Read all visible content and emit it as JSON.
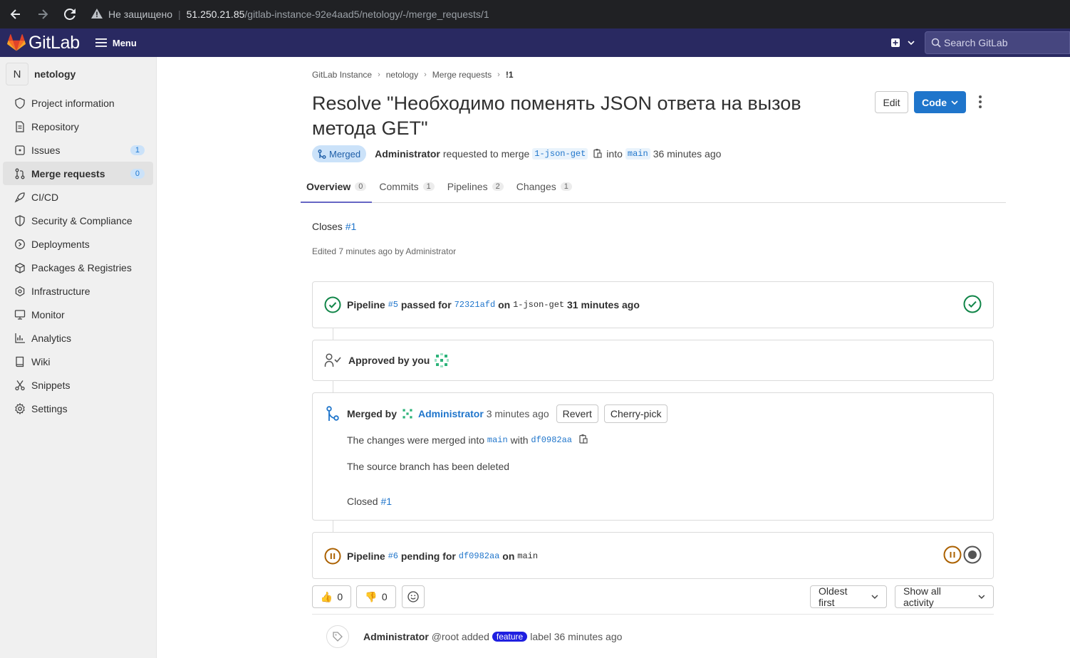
{
  "browser": {
    "security_label": "Не защищено",
    "url_host": "51.250.21.85",
    "url_path": "/gitlab-instance-92e4aad5/netology/-/merge_requests/1"
  },
  "topbar": {
    "logo_text": "GitLab",
    "menu_label": "Menu",
    "search_placeholder": "Search GitLab"
  },
  "sidebar": {
    "project_initial": "N",
    "project_name": "netology",
    "items": [
      {
        "label": "Project information",
        "icon": "info-icon"
      },
      {
        "label": "Repository",
        "icon": "doc-icon"
      },
      {
        "label": "Issues",
        "icon": "issues-icon",
        "count": "1"
      },
      {
        "label": "Merge requests",
        "icon": "merge-request-icon",
        "count": "0",
        "active": true
      },
      {
        "label": "CI/CD",
        "icon": "rocket-icon"
      },
      {
        "label": "Security & Compliance",
        "icon": "shield-icon"
      },
      {
        "label": "Deployments",
        "icon": "deployments-icon"
      },
      {
        "label": "Packages & Registries",
        "icon": "package-icon"
      },
      {
        "label": "Infrastructure",
        "icon": "cloud-icon"
      },
      {
        "label": "Monitor",
        "icon": "monitor-icon"
      },
      {
        "label": "Analytics",
        "icon": "chart-icon"
      },
      {
        "label": "Wiki",
        "icon": "book-icon"
      },
      {
        "label": "Snippets",
        "icon": "scissors-icon"
      },
      {
        "label": "Settings",
        "icon": "gear-icon"
      }
    ]
  },
  "breadcrumb": [
    "GitLab Instance",
    "netology",
    "Merge requests",
    "!1"
  ],
  "mr": {
    "title": "Resolve \"Необходимо поменять JSON ответа на вызов метода GET\"",
    "edit_label": "Edit",
    "code_label": "Code",
    "status": "Merged",
    "author": "Administrator",
    "requested_text": "requested to merge",
    "source_branch": "1-json-get",
    "into_text": "into",
    "target_branch": "main",
    "time": "36 minutes ago"
  },
  "tabs": [
    {
      "label": "Overview",
      "count": "0",
      "active": true
    },
    {
      "label": "Commits",
      "count": "1"
    },
    {
      "label": "Pipelines",
      "count": "2"
    },
    {
      "label": "Changes",
      "count": "1"
    }
  ],
  "description": {
    "closes_text": "Closes",
    "closes_ref": "#1",
    "edited": "Edited 7 minutes ago by Administrator"
  },
  "pipeline1": {
    "label": "Pipeline",
    "id": "#5",
    "status_text": "passed for",
    "commit": "72321afd",
    "on_text": "on",
    "branch": "1-json-get",
    "time": "31 minutes ago"
  },
  "approval": {
    "text": "Approved by you"
  },
  "merge": {
    "merged_by_text": "Merged by",
    "user": "Administrator",
    "time": "3 minutes ago",
    "revert_label": "Revert",
    "cherry_label": "Cherry-pick",
    "changes_prefix": "The changes were merged into",
    "branch": "main",
    "with_text": "with",
    "commit": "df0982aa",
    "deleted_text": "The source branch has been deleted",
    "closed_text": "Closed",
    "closed_ref": "#1"
  },
  "pipeline2": {
    "label": "Pipeline",
    "id": "#6",
    "status_text": "pending for",
    "commit": "df0982aa",
    "on_text": "on",
    "branch": "main"
  },
  "reactions": {
    "thumbs_up": "0",
    "thumbs_down": "0",
    "sort_label": "Oldest first",
    "filter_label": "Show all activity"
  },
  "activity": {
    "user": "Administrator",
    "handle": "@root",
    "added_text": "added",
    "label": "feature",
    "suffix": "label 36 minutes ago"
  },
  "colors": {
    "topbar": "#292961",
    "primary": "#1f75cb",
    "success": "#108548",
    "pending": "#ab6100",
    "feature_label": "#1f1fe0"
  }
}
